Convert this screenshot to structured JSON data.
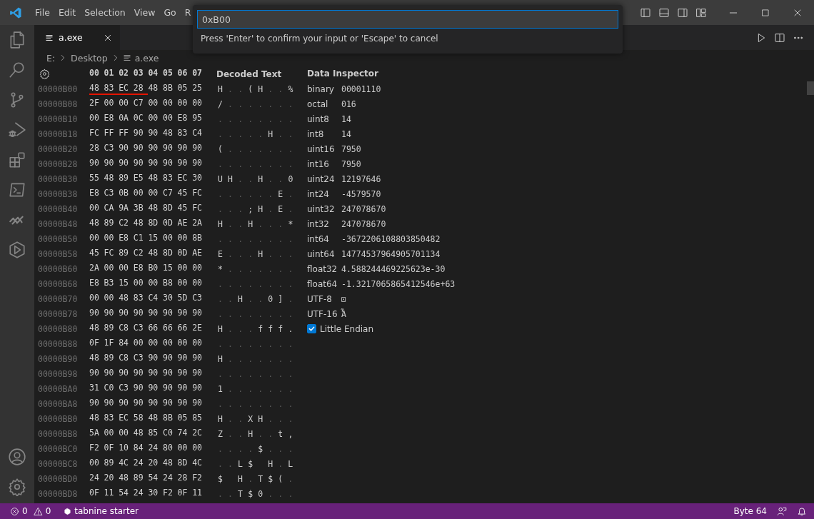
{
  "title_bar": {
    "menu": [
      "File",
      "Edit",
      "Selection",
      "View",
      "Go",
      "R"
    ]
  },
  "quick_input": {
    "value": "0xB00",
    "message": "Press 'Enter' to confirm your input or 'Escape' to cancel"
  },
  "tabs": [
    {
      "label": "a.exe",
      "selected": true
    }
  ],
  "breadcrumb": [
    "E:",
    "Desktop",
    "a.exe"
  ],
  "hex_view": {
    "columns": [
      "00",
      "01",
      "02",
      "03",
      "04",
      "05",
      "06",
      "07"
    ],
    "decoded_heading": "Decoded Text",
    "rows": [
      {
        "offset": "00000B00",
        "bytes": "48 83 EC 28 48 8B 05 25",
        "decoded": "H . . ( H . . %",
        "underlined": [
          true,
          true,
          true,
          true,
          false,
          false,
          false,
          false
        ]
      },
      {
        "offset": "00000B08",
        "bytes": "2F 00 00 C7 00 00 00 00",
        "decoded": "/ . . . . . . ."
      },
      {
        "offset": "00000B10",
        "bytes": "00 E8 0A 0C 00 00 E8 95",
        "decoded": ". . . . . . . ."
      },
      {
        "offset": "00000B18",
        "bytes": "FC FF FF 90 90 48 83 C4",
        "decoded": ". . . . . H . ."
      },
      {
        "offset": "00000B20",
        "bytes": "28 C3 90 90 90 90 90 90",
        "decoded": "( . . . . . . ."
      },
      {
        "offset": "00000B28",
        "bytes": "90 90 90 90 90 90 90 90",
        "decoded": ". . . . . . . ."
      },
      {
        "offset": "00000B30",
        "bytes": "55 48 89 E5 48 83 EC 30",
        "decoded": "U H . . H . . 0"
      },
      {
        "offset": "00000B38",
        "bytes": "E8 C3 0B 00 00 C7 45 FC",
        "decoded": ". . . . . . E ."
      },
      {
        "offset": "00000B40",
        "bytes": "00 CA 9A 3B 48 8D 45 FC",
        "decoded": ". . . ; H . E ."
      },
      {
        "offset": "00000B48",
        "bytes": "48 89 C2 48 8D 0D AE 2A",
        "decoded": "H . . H . . . *"
      },
      {
        "offset": "00000B50",
        "bytes": "00 00 E8 C1 15 00 00 8B",
        "decoded": ". . . . . . . ."
      },
      {
        "offset": "00000B58",
        "bytes": "45 FC 89 C2 48 8D 0D AE",
        "decoded": "E . . . H . . ."
      },
      {
        "offset": "00000B60",
        "bytes": "2A 00 00 E8 B0 15 00 00",
        "decoded": "* . . . . . . ."
      },
      {
        "offset": "00000B68",
        "bytes": "E8 B3 15 00 00 B8 00 00",
        "decoded": ". . . . . . . ."
      },
      {
        "offset": "00000B70",
        "bytes": "00 00 48 83 C4 30 5D C3",
        "decoded": ". . H . . 0 ] ."
      },
      {
        "offset": "00000B78",
        "bytes": "90 90 90 90 90 90 90 90",
        "decoded": ". . . . . . . ."
      },
      {
        "offset": "00000B80",
        "bytes": "48 89 C8 C3 66 66 66 2E",
        "decoded": "H . . . f f f ."
      },
      {
        "offset": "00000B88",
        "bytes": "0F 1F 84 00 00 00 00 00",
        "decoded": ". . . . . . . ."
      },
      {
        "offset": "00000B90",
        "bytes": "48 89 C8 C3 90 90 90 90",
        "decoded": "H . . . . . . ."
      },
      {
        "offset": "00000B98",
        "bytes": "90 90 90 90 90 90 90 90",
        "decoded": ". . . . . . . ."
      },
      {
        "offset": "00000BA0",
        "bytes": "31 C0 C3 90 90 90 90 90",
        "decoded": "1 . . . . . . ."
      },
      {
        "offset": "00000BA8",
        "bytes": "90 90 90 90 90 90 90 90",
        "decoded": ". . . . . . . ."
      },
      {
        "offset": "00000BB0",
        "bytes": "48 83 EC 58 48 8B 05 85",
        "decoded": "H . . X H . . ."
      },
      {
        "offset": "00000BB8",
        "bytes": "5A 00 00 48 85 C0 74 2C",
        "decoded": "Z . . H . . t ,"
      },
      {
        "offset": "00000BC0",
        "bytes": "F2 0F 10 84 24 80 00 00",
        "decoded": ". . . . $ . . ."
      },
      {
        "offset": "00000BC8",
        "bytes": "00 89 4C 24 20 48 8D 4C",
        "decoded": ". . L $   H . L"
      },
      {
        "offset": "00000BD0",
        "bytes": "24 20 48 89 54 24 28 F2",
        "decoded": "$   H . T $ ( ."
      },
      {
        "offset": "00000BD8",
        "bytes": "0F 11 54 24 30 F2 0F 11",
        "decoded": ". . T $ 0 . . ."
      }
    ]
  },
  "data_inspector": {
    "title": "Data Inspector",
    "fields": [
      {
        "label": "binary",
        "value": "00001110"
      },
      {
        "label": "octal",
        "value": "016"
      },
      {
        "label": "uint8",
        "value": "14"
      },
      {
        "label": "int8",
        "value": "14"
      },
      {
        "label": "uint16",
        "value": "7950"
      },
      {
        "label": "int16",
        "value": "7950"
      },
      {
        "label": "uint24",
        "value": "12197646"
      },
      {
        "label": "int24",
        "value": "-4579570"
      },
      {
        "label": "uint32",
        "value": "247078670"
      },
      {
        "label": "int32",
        "value": "247078670"
      },
      {
        "label": "int64",
        "value": "-3672206108803850482"
      },
      {
        "label": "uint64",
        "value": "14774537964905701134"
      },
      {
        "label": "float32",
        "value": "4.588244469225623e-30"
      },
      {
        "label": "float64",
        "value": "-1.3217065865412546e+63"
      },
      {
        "label": "UTF-8",
        "value": "⊡"
      },
      {
        "label": "UTF-16",
        "value": "Ἆ"
      }
    ],
    "little_endian": {
      "label": "Little Endian",
      "checked": true
    }
  },
  "status_bar": {
    "errors": "0",
    "warnings": "0",
    "extension": "tabnine starter",
    "position": "Byte 64"
  }
}
